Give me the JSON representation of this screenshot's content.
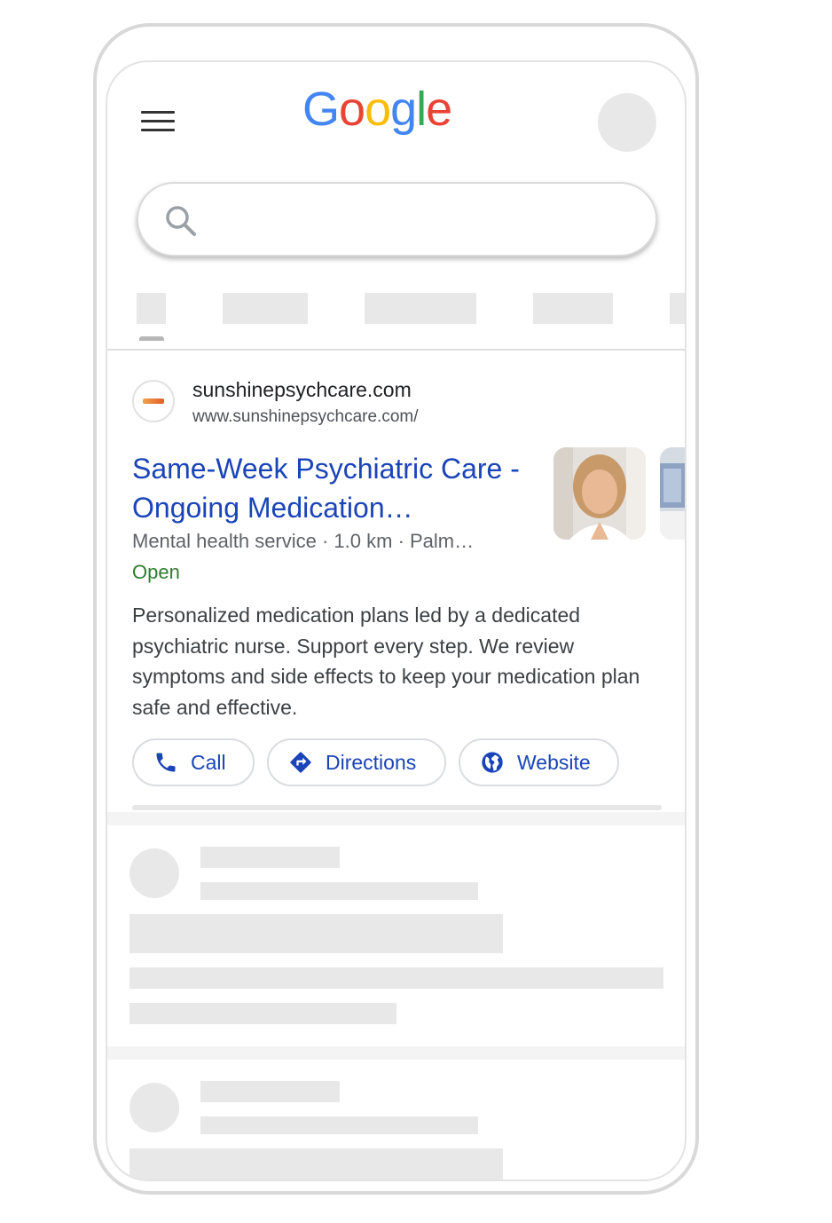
{
  "header": {
    "logo": [
      {
        "ch": "G",
        "color": "#4285F4"
      },
      {
        "ch": "o",
        "color": "#EA4335"
      },
      {
        "ch": "o",
        "color": "#FBBC05"
      },
      {
        "ch": "g",
        "color": "#4285F4"
      },
      {
        "ch": "l",
        "color": "#34A853"
      },
      {
        "ch": "e",
        "color": "#EA4335"
      }
    ]
  },
  "result": {
    "site_name": "sunshinepsychcare.com",
    "site_url": "www.sunshinepsychcare.com/",
    "title": "Same-Week Psychiatric Care - Ongoing Medication…",
    "meta": "Mental health service · 1.0 km · Palm…",
    "status": "Open",
    "description": "Personalized medication plans led by a dedicated psychiatric nurse. Support every step. We review symptoms and side effects to keep your medication plan safe and effective.",
    "actions": {
      "call": "Call",
      "directions": "Directions",
      "website": "Website"
    }
  },
  "colors": {
    "link_blue": "#1a44b8",
    "open_green": "#2e7d32"
  }
}
